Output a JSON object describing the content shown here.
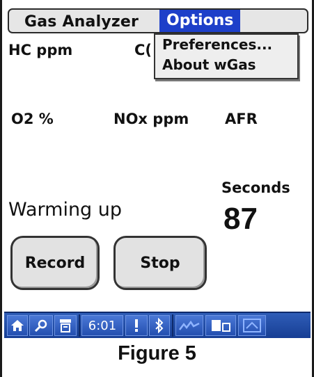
{
  "app": {
    "title": "Gas Analyzer",
    "menu_open": "Options"
  },
  "dropdown": {
    "items": [
      "Preferences...",
      "About wGas"
    ]
  },
  "readings": {
    "hc": "HC ppm",
    "co_partial": "C(",
    "o2": "O2 %",
    "nox": "NOx ppm",
    "afr": "AFR"
  },
  "status": "Warming up",
  "timer": {
    "label": "Seconds",
    "value": "87"
  },
  "buttons": {
    "record": "Record",
    "stop": "Stop"
  },
  "taskbar": {
    "time": "6:01",
    "icons": [
      "home-icon",
      "search-icon",
      "app-menu-icon",
      "alert-icon",
      "bluetooth-icon",
      "signal-icon",
      "device-icon",
      "network-icon"
    ]
  },
  "caption": "Figure 5",
  "colors": {
    "menu_highlight": "#1d3fc9",
    "taskbar": "#2448a4"
  }
}
